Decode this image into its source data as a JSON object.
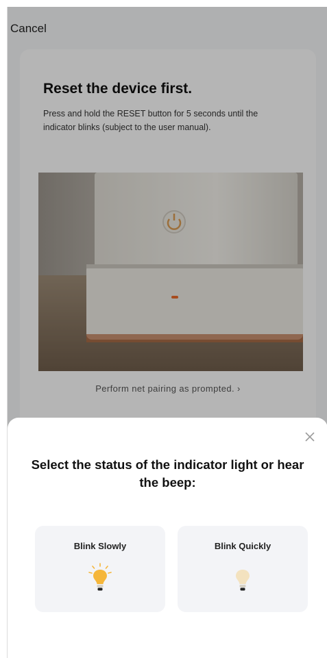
{
  "header": {
    "cancel_label": "Cancel"
  },
  "card": {
    "title": "Reset the device first.",
    "description": "Press and hold the RESET button for 5 seconds until the indicator blinks (subject to the user manual).",
    "pairing_link": "Perform net pairing as prompted. ›"
  },
  "sheet": {
    "title": "Select the status of the indicator light or hear the beep:",
    "options": [
      {
        "label": "Blink Slowly",
        "icon": "blinking-bulb-icon"
      },
      {
        "label": "Blink Quickly",
        "icon": "bulb-icon"
      }
    ],
    "close_icon": "close-icon"
  },
  "colors": {
    "bulb_on": "#f5b63a",
    "bulb_dim": "#f3e2bf",
    "sheet_bg": "#ffffff",
    "option_bg": "#f3f4f7"
  }
}
